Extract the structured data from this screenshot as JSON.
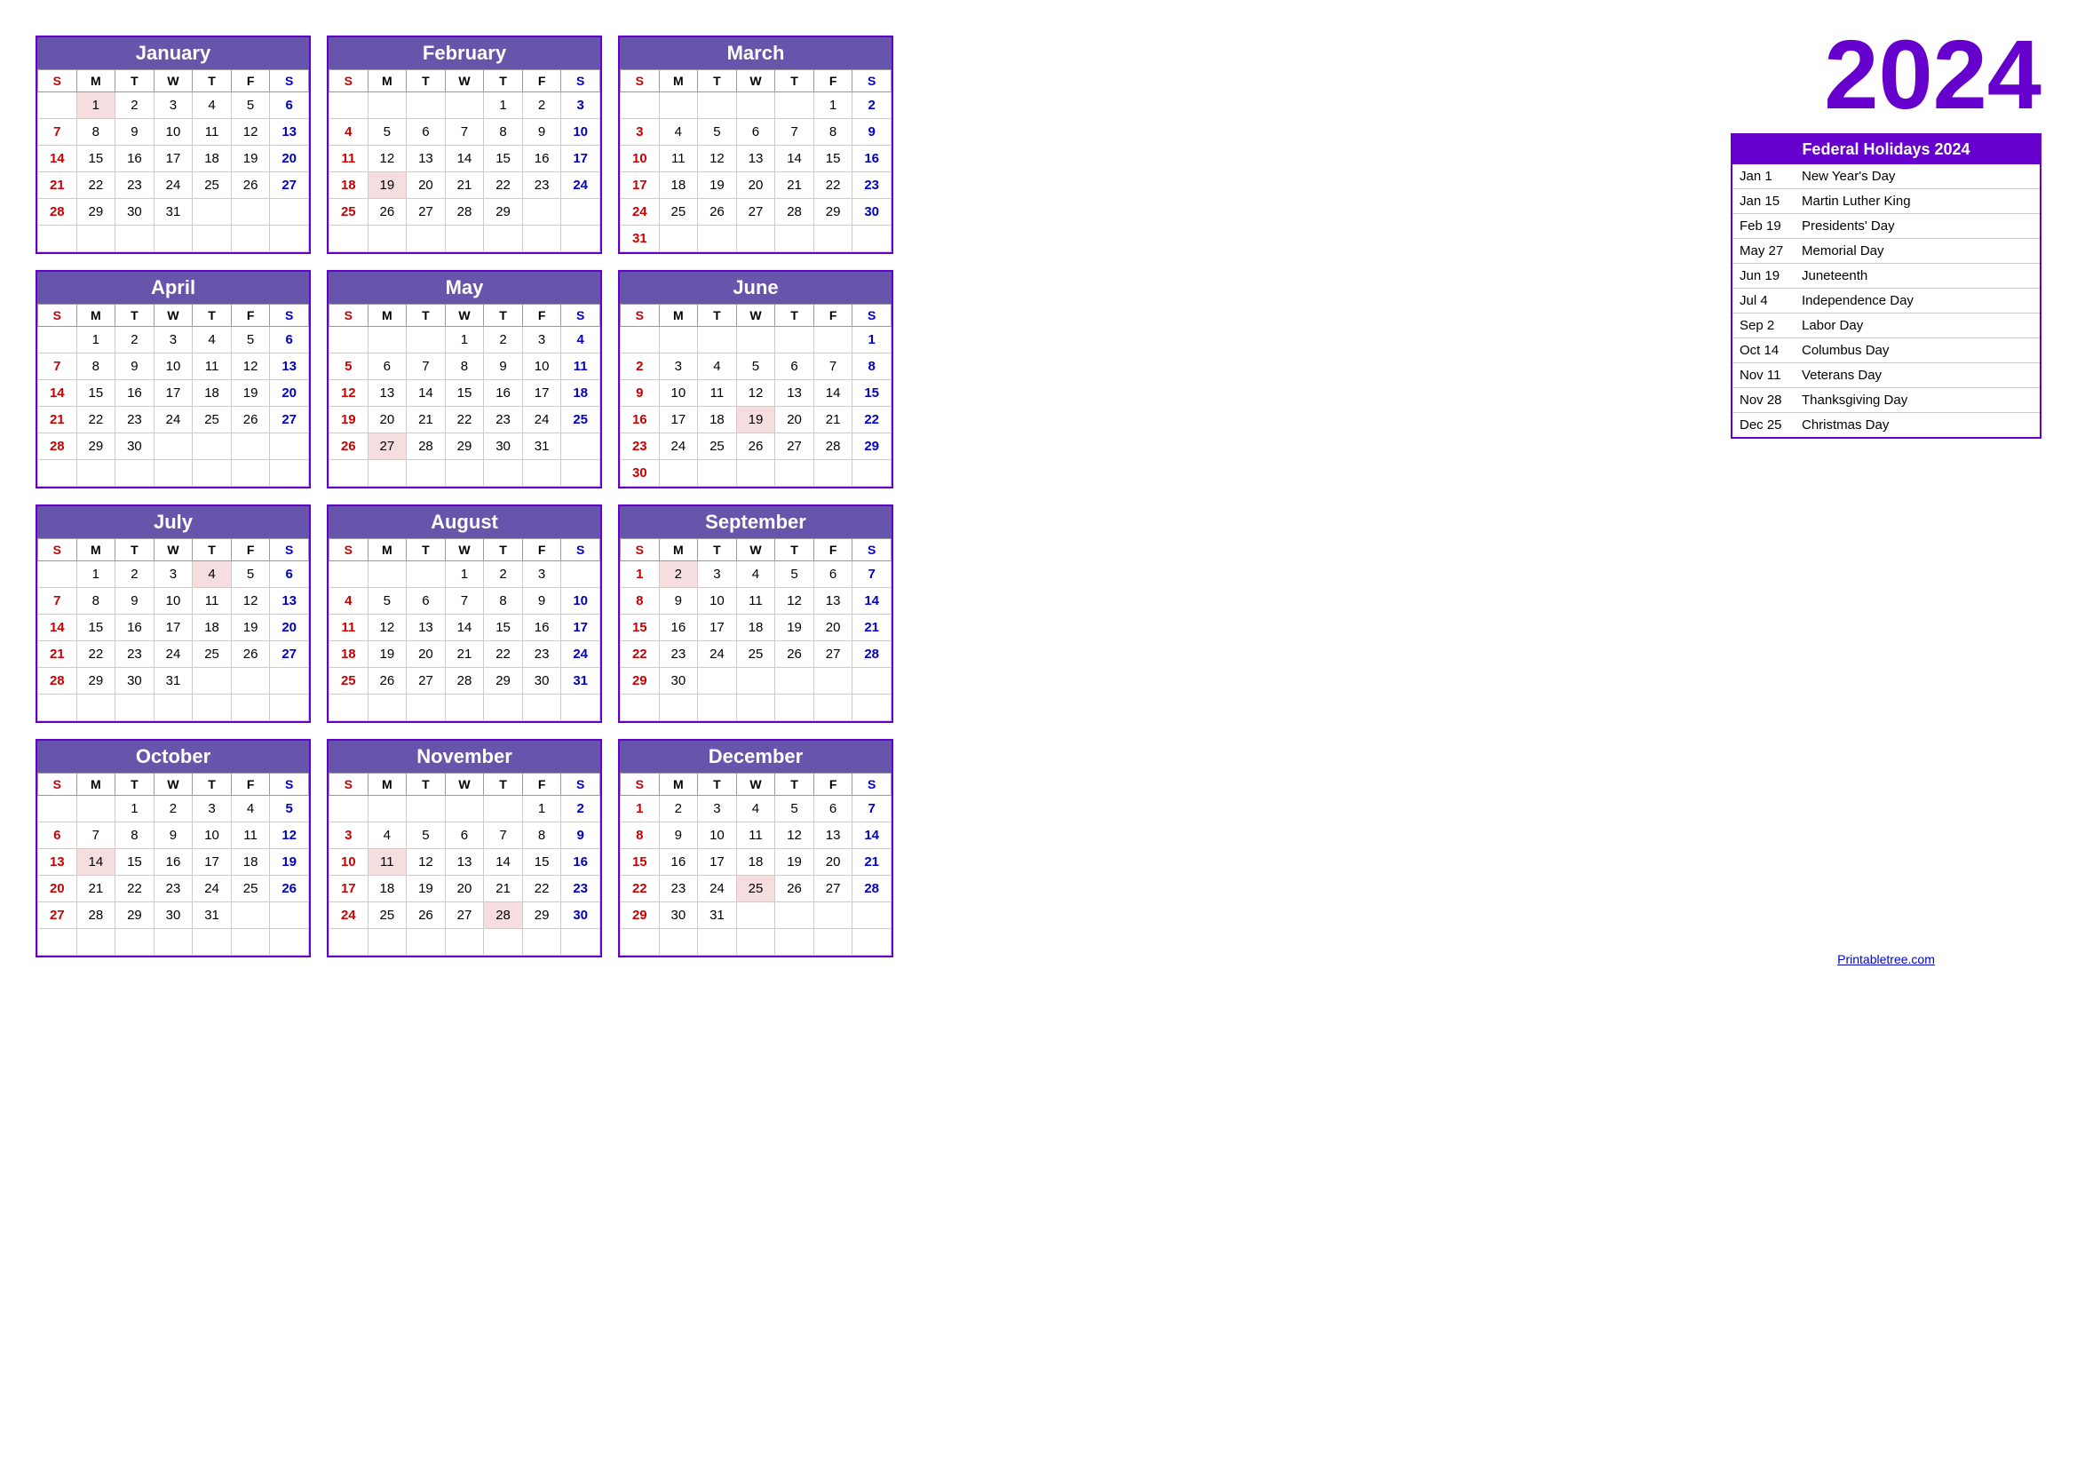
{
  "year": "2024",
  "holidays_header": "Federal Holidays 2024",
  "holidays": [
    {
      "date": "Jan 1",
      "name": "New Year's Day"
    },
    {
      "date": "Jan 15",
      "name": "Martin Luther King"
    },
    {
      "date": "Feb 19",
      "name": "Presidents' Day"
    },
    {
      "date": "May 27",
      "name": "Memorial Day"
    },
    {
      "date": "Jun 19",
      "name": "Juneteenth"
    },
    {
      "date": "Jul 4",
      "name": "Independence Day"
    },
    {
      "date": "Sep 2",
      "name": "Labor Day"
    },
    {
      "date": "Oct 14",
      "name": "Columbus Day"
    },
    {
      "date": "Nov 11",
      "name": "Veterans Day"
    },
    {
      "date": "Nov 28",
      "name": "Thanksgiving Day"
    },
    {
      "date": "Dec 25",
      "name": "Christmas Day"
    }
  ],
  "printable_link": "Printabletree.com",
  "months": [
    {
      "name": "January",
      "weeks": [
        [
          "",
          "1",
          "2",
          "3",
          "4",
          "5",
          "6"
        ],
        [
          "7",
          "8",
          "9",
          "10",
          "11",
          "12",
          "13"
        ],
        [
          "14",
          "15",
          "16",
          "17",
          "18",
          "19",
          "20"
        ],
        [
          "21",
          "22",
          "23",
          "24",
          "25",
          "26",
          "27"
        ],
        [
          "28",
          "29",
          "30",
          "31",
          "",
          "",
          ""
        ],
        [
          "",
          "",
          "",
          "",
          "",
          "",
          ""
        ]
      ],
      "holidays": [
        "1"
      ]
    },
    {
      "name": "February",
      "weeks": [
        [
          "",
          "",
          "",
          "",
          "1",
          "2",
          "3"
        ],
        [
          "4",
          "5",
          "6",
          "7",
          "8",
          "9",
          "10"
        ],
        [
          "11",
          "12",
          "13",
          "14",
          "15",
          "16",
          "17"
        ],
        [
          "18",
          "19",
          "20",
          "21",
          "22",
          "23",
          "24"
        ],
        [
          "25",
          "26",
          "27",
          "28",
          "29",
          "",
          ""
        ],
        [
          "",
          "",
          "",
          "",
          "",
          "",
          ""
        ]
      ],
      "holidays": [
        "19"
      ]
    },
    {
      "name": "March",
      "weeks": [
        [
          "",
          "",
          "",
          "",
          "",
          "1",
          "2"
        ],
        [
          "3",
          "4",
          "5",
          "6",
          "7",
          "8",
          "9"
        ],
        [
          "10",
          "11",
          "12",
          "13",
          "14",
          "15",
          "16"
        ],
        [
          "17",
          "18",
          "19",
          "20",
          "21",
          "22",
          "23"
        ],
        [
          "24",
          "25",
          "26",
          "27",
          "28",
          "29",
          "30"
        ],
        [
          "31",
          "",
          "",
          "",
          "",
          "",
          ""
        ]
      ],
      "holidays": []
    },
    {
      "name": "April",
      "weeks": [
        [
          "",
          "1",
          "2",
          "3",
          "4",
          "5",
          "6"
        ],
        [
          "7",
          "8",
          "9",
          "10",
          "11",
          "12",
          "13"
        ],
        [
          "14",
          "15",
          "16",
          "17",
          "18",
          "19",
          "20"
        ],
        [
          "21",
          "22",
          "23",
          "24",
          "25",
          "26",
          "27"
        ],
        [
          "28",
          "29",
          "30",
          "",
          "",
          "",
          ""
        ],
        [
          "",
          "",
          "",
          "",
          "",
          "",
          ""
        ]
      ],
      "holidays": []
    },
    {
      "name": "May",
      "weeks": [
        [
          "",
          "",
          "",
          "1",
          "2",
          "3",
          "4"
        ],
        [
          "5",
          "6",
          "7",
          "8",
          "9",
          "10",
          "11"
        ],
        [
          "12",
          "13",
          "14",
          "15",
          "16",
          "17",
          "18"
        ],
        [
          "19",
          "20",
          "21",
          "22",
          "23",
          "24",
          "25"
        ],
        [
          "26",
          "27",
          "28",
          "29",
          "30",
          "31",
          ""
        ],
        [
          "",
          "",
          "",
          "",
          "",
          "",
          ""
        ]
      ],
      "holidays": [
        "27"
      ]
    },
    {
      "name": "June",
      "weeks": [
        [
          "",
          "",
          "",
          "",
          "",
          "",
          "1"
        ],
        [
          "2",
          "3",
          "4",
          "5",
          "6",
          "7",
          "8"
        ],
        [
          "9",
          "10",
          "11",
          "12",
          "13",
          "14",
          "15"
        ],
        [
          "16",
          "17",
          "18",
          "19",
          "20",
          "21",
          "22"
        ],
        [
          "23",
          "24",
          "25",
          "26",
          "27",
          "28",
          "29"
        ],
        [
          "30",
          "",
          "",
          "",
          "",
          "",
          ""
        ]
      ],
      "holidays": [
        "19"
      ]
    },
    {
      "name": "July",
      "weeks": [
        [
          "",
          "1",
          "2",
          "3",
          "4",
          "5",
          "6"
        ],
        [
          "7",
          "8",
          "9",
          "10",
          "11",
          "12",
          "13"
        ],
        [
          "14",
          "15",
          "16",
          "17",
          "18",
          "19",
          "20"
        ],
        [
          "21",
          "22",
          "23",
          "24",
          "25",
          "26",
          "27"
        ],
        [
          "28",
          "29",
          "30",
          "31",
          "",
          "",
          ""
        ],
        [
          "",
          "",
          "",
          "",
          "",
          "",
          ""
        ]
      ],
      "holidays": [
        "4"
      ]
    },
    {
      "name": "August",
      "weeks": [
        [
          "",
          "",
          "",
          "1",
          "2",
          "3",
          ""
        ],
        [
          "4",
          "5",
          "6",
          "7",
          "8",
          "9",
          "10"
        ],
        [
          "11",
          "12",
          "13",
          "14",
          "15",
          "16",
          "17"
        ],
        [
          "18",
          "19",
          "20",
          "21",
          "22",
          "23",
          "24"
        ],
        [
          "25",
          "26",
          "27",
          "28",
          "29",
          "30",
          "31"
        ],
        [
          "",
          "",
          "",
          "",
          "",
          "",
          ""
        ]
      ],
      "holidays": []
    },
    {
      "name": "September",
      "weeks": [
        [
          "1",
          "2",
          "3",
          "4",
          "5",
          "6",
          "7"
        ],
        [
          "8",
          "9",
          "10",
          "11",
          "12",
          "13",
          "14"
        ],
        [
          "15",
          "16",
          "17",
          "18",
          "19",
          "20",
          "21"
        ],
        [
          "22",
          "23",
          "24",
          "25",
          "26",
          "27",
          "28"
        ],
        [
          "29",
          "30",
          "",
          "",
          "",
          "",
          ""
        ],
        [
          "",
          "",
          "",
          "",
          "",
          "",
          ""
        ]
      ],
      "holidays": [
        "2"
      ]
    },
    {
      "name": "October",
      "weeks": [
        [
          "",
          "",
          "1",
          "2",
          "3",
          "4",
          "5"
        ],
        [
          "6",
          "7",
          "8",
          "9",
          "10",
          "11",
          "12"
        ],
        [
          "13",
          "14",
          "15",
          "16",
          "17",
          "18",
          "19"
        ],
        [
          "20",
          "21",
          "22",
          "23",
          "24",
          "25",
          "26"
        ],
        [
          "27",
          "28",
          "29",
          "30",
          "31",
          "",
          ""
        ],
        [
          "",
          "",
          "",
          "",
          "",
          "",
          ""
        ]
      ],
      "holidays": [
        "14"
      ]
    },
    {
      "name": "November",
      "weeks": [
        [
          "",
          "",
          "",
          "",
          "",
          "1",
          "2"
        ],
        [
          "3",
          "4",
          "5",
          "6",
          "7",
          "8",
          "9"
        ],
        [
          "10",
          "11",
          "12",
          "13",
          "14",
          "15",
          "16"
        ],
        [
          "17",
          "18",
          "19",
          "20",
          "21",
          "22",
          "23"
        ],
        [
          "24",
          "25",
          "26",
          "27",
          "28",
          "29",
          "30"
        ],
        [
          "",
          "",
          "",
          "",
          "",
          "",
          ""
        ]
      ],
      "holidays": [
        "11",
        "28"
      ]
    },
    {
      "name": "December",
      "weeks": [
        [
          "1",
          "2",
          "3",
          "4",
          "5",
          "6",
          "7"
        ],
        [
          "8",
          "9",
          "10",
          "11",
          "12",
          "13",
          "14"
        ],
        [
          "15",
          "16",
          "17",
          "18",
          "19",
          "20",
          "21"
        ],
        [
          "22",
          "23",
          "24",
          "25",
          "26",
          "27",
          "28"
        ],
        [
          "29",
          "30",
          "31",
          "",
          "",
          "",
          ""
        ],
        [
          "",
          "",
          "",
          "",
          "",
          "",
          ""
        ]
      ],
      "holidays": [
        "25"
      ]
    }
  ],
  "day_headers": [
    "S",
    "M",
    "T",
    "W",
    "T",
    "F",
    "S"
  ]
}
